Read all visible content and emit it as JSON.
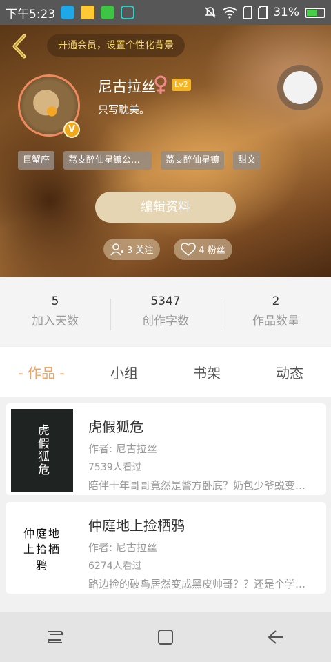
{
  "status_bar": {
    "time": "下午5:23",
    "battery": "31%"
  },
  "header": {
    "vip_banner": "开通会员，设置个性化背景",
    "username": "尼古拉丝",
    "level": "Lv2",
    "vip_badge": "V",
    "bio": "只写耽美。",
    "tags": [
      "巨蟹座",
      "荔支醉仙星镇公众…",
      "荔支醉仙星镇",
      "甜文"
    ],
    "edit_label": "编辑资料",
    "following_label": "3 关注",
    "followers_label": "4 粉丝"
  },
  "stats": [
    {
      "value": "5",
      "label": "加入天数"
    },
    {
      "value": "5347",
      "label": "创作字数"
    },
    {
      "value": "2",
      "label": "作品数量"
    }
  ],
  "tabs": [
    "- 作品 -",
    "小组",
    "书架",
    "动态"
  ],
  "works": [
    {
      "cover_text": "虎假狐危",
      "title": "虎假狐危",
      "author": "作者: 尼古拉丝",
      "views": "7539人看过",
      "desc": "陪伴十年哥哥竟然是警方卧底？奶包少爷蜕变…"
    },
    {
      "cover_text": "仲庭地上拾栖鸦",
      "title": "仲庭地上捡栖鸦",
      "author": "作者: 尼古拉丝",
      "views": "6274人看过",
      "desc": "路边捡的破鸟居然变成黑皮帅哥？？还是个学…"
    }
  ],
  "colors": {
    "accent": "#f5a364",
    "vip_gold": "#f4d66b",
    "level_badge": "#f3b426"
  }
}
